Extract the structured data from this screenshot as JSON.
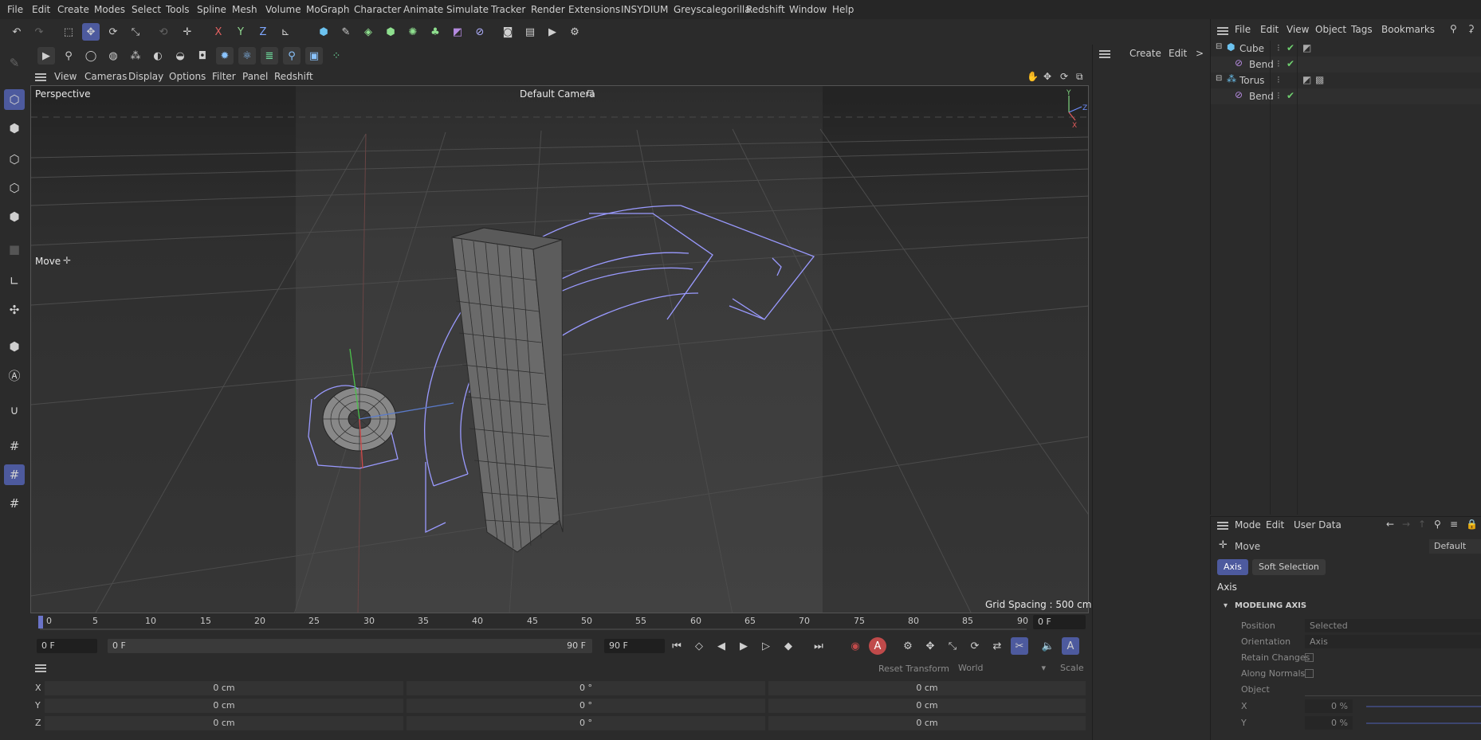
{
  "menu": [
    "File",
    "Edit",
    "Create",
    "Modes",
    "Select",
    "Tools",
    "Spline",
    "Mesh",
    "Volume",
    "MoGraph",
    "Character",
    "Animate",
    "Simulate",
    "Tracker",
    "Render",
    "Extensions",
    "INSYDIUM",
    "Greyscalegorilla",
    "Redshift",
    "Window",
    "Help"
  ],
  "axis_buttons": {
    "x": "X",
    "y": "Y",
    "z": "Z"
  },
  "viewport_menu": [
    "View",
    "Cameras",
    "Display",
    "Options",
    "Filter",
    "Panel",
    "Redshift"
  ],
  "viewport": {
    "view_name": "Perspective",
    "camera": "Default Camera",
    "tool_name": "Move",
    "grid_spacing": "Grid Spacing : 500 cm"
  },
  "timeline": {
    "ticks": [
      "0",
      "5",
      "10",
      "15",
      "20",
      "25",
      "30",
      "35",
      "40",
      "45",
      "50",
      "55",
      "60",
      "65",
      "70",
      "75",
      "80",
      "85",
      "90"
    ],
    "current_frame_display": "0 F",
    "start_field": "0 F",
    "range_start": "0 F",
    "range_end": "90 F",
    "end_field": "90 F"
  },
  "coords": {
    "reset_transform": "Reset Transform",
    "space": "World",
    "mode": "Scale",
    "rows": [
      {
        "axis": "X",
        "pos": "0 cm",
        "rot": "0 °",
        "size": "0 cm"
      },
      {
        "axis": "Y",
        "pos": "0 cm",
        "rot": "0 °",
        "size": "0 cm"
      },
      {
        "axis": "Z",
        "pos": "0 cm",
        "rot": "0 °",
        "size": "0 cm"
      }
    ]
  },
  "mid_panel": {
    "create": "Create",
    "edit": "Edit",
    "more": ">"
  },
  "object_manager": {
    "menu": [
      "File",
      "Edit",
      "View",
      "Object",
      "Tags",
      "Bookmarks"
    ],
    "objects": [
      {
        "name": "Cube",
        "indent": 0,
        "type": "cube"
      },
      {
        "name": "Bend",
        "indent": 1,
        "type": "deformer"
      },
      {
        "name": "Torus",
        "indent": 0,
        "type": "torus"
      },
      {
        "name": "Bend",
        "indent": 1,
        "type": "deformer"
      }
    ]
  },
  "attributes": {
    "menu": [
      "Mode",
      "Edit",
      "User Data"
    ],
    "tool": "Move",
    "preset": "Default",
    "tabs": [
      "Axis",
      "Soft Selection"
    ],
    "active_tab": "Axis",
    "section": "Axis",
    "group": "MODELING AXIS",
    "fields": {
      "position_label": "Position",
      "position_value": "Selected",
      "orientation_label": "Orientation",
      "orientation_value": "Axis",
      "retain_label": "Retain Changes",
      "along_label": "Along Normals",
      "object_label": "Object",
      "x_label": "X",
      "x_value": "0 %",
      "y_label": "Y",
      "y_value": "0 %"
    }
  }
}
